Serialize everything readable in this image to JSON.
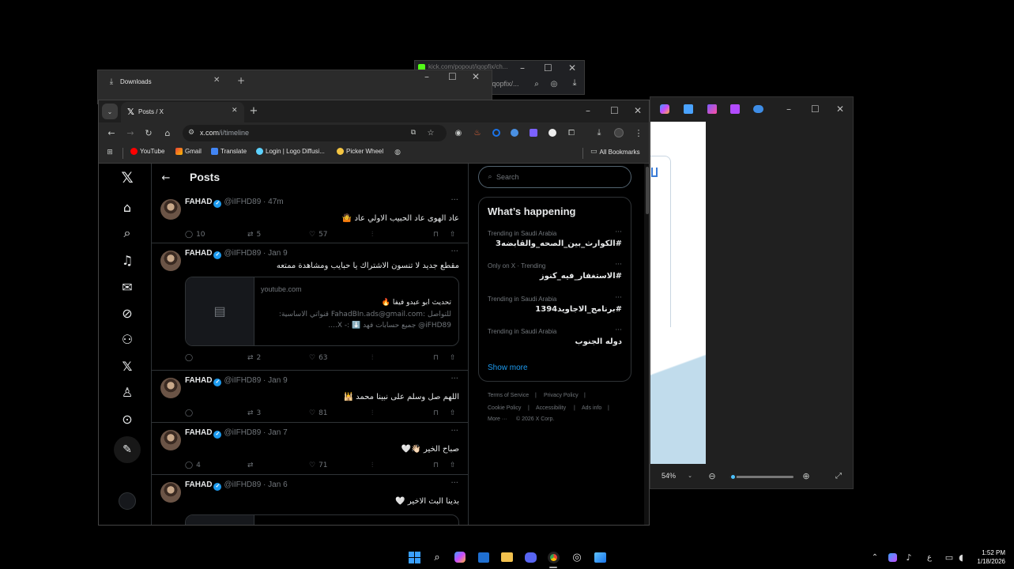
{
  "kick_window": {
    "url": "kick.com/popout/iqopfix/ch...",
    "url2": "/iqopfix/..."
  },
  "downloads_window": {
    "tab_title": "Downloads"
  },
  "photos_window": {
    "zoom": "54%"
  },
  "chrome": {
    "tab_title": "Posts / X",
    "url_host": "x.com",
    "url_path": "/i/timeline",
    "bookmarks": [
      "YouTube",
      "Gmail",
      "Translate",
      "Login | Logo Diffusi...",
      "Picker Wheel"
    ],
    "all_bookmarks": "All Bookmarks"
  },
  "x": {
    "header_title": "Posts",
    "posts": [
      {
        "name": "FAHAD",
        "handle": "@iIFHD89",
        "time": "47m",
        "text": "عاد الهوى عاد الحبيب الاولي عاد 🤷",
        "replies": "10",
        "reposts": "5",
        "likes": "57"
      },
      {
        "name": "FAHAD",
        "handle": "@iIFHD89",
        "time": "Jan 9",
        "text": "مقطع جديد لا تنسون الاشتراك يا حبايب ومشاهدة ممتعه",
        "card": {
          "domain": "youtube.com",
          "title": "تحديث ابو عبدو فيفا 🔥",
          "line1": "للتواصل :FahadBIn.ads@gmail.com قنواتي الاساسية:",
          "line2": "iFHD89@ جميع حسابات فهد ⬇️ :- X...."
        },
        "replies": "",
        "reposts": "2",
        "likes": "63"
      },
      {
        "name": "FAHAD",
        "handle": "@iIFHD89",
        "time": "Jan 9",
        "text": "اللهم صل وسلم على نبينا محمد 🕌",
        "replies": "",
        "reposts": "3",
        "likes": "81"
      },
      {
        "name": "FAHAD",
        "handle": "@iIFHD89",
        "time": "Jan 7",
        "text": "صباح الخير 👋🏻🤍",
        "replies": "4",
        "reposts": "",
        "likes": "71"
      },
      {
        "name": "FAHAD",
        "handle": "@iIFHD89",
        "time": "Jan 6",
        "text": "بدينا البث الاخير 🤍"
      }
    ],
    "search_placeholder": "Search",
    "happening_title": "What’s happening",
    "trends": [
      {
        "meta": "Trending in Saudi Arabia",
        "name": "#الكوارث_بين_الصحه_والقابضه3"
      },
      {
        "meta": "Only on X · Trending",
        "name": "#الاستغفار_فيه_كنوز"
      },
      {
        "meta": "Trending in Saudi Arabia",
        "name": "#برنامج_الاجاويد1394"
      },
      {
        "meta": "Trending in Saudi Arabia",
        "name": "دوله الجنوب"
      }
    ],
    "show_more": "Show more",
    "footer": [
      "Terms of Service",
      "Privacy Policy",
      "Cookie Policy",
      "Accessibility",
      "Ads info",
      "More ···",
      "© 2026 X Corp."
    ]
  },
  "taskbar": {
    "time": "1:52 PM",
    "date": "1/18/2026",
    "lang": "ع"
  },
  "colors": {
    "accent": "#1d9bf0",
    "background": "#000000",
    "border": "#2f3336",
    "muted": "#71767b"
  }
}
